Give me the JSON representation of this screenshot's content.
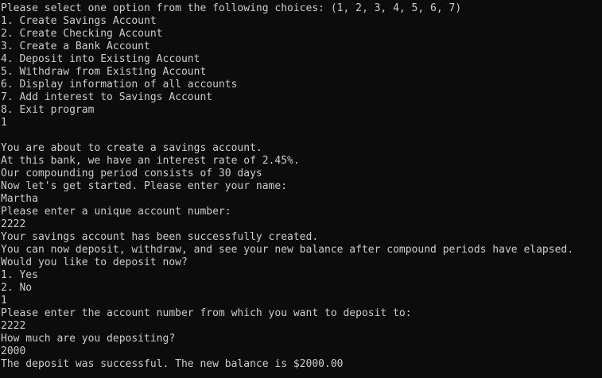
{
  "console": {
    "lines": [
      "Please select one option from the following choices: (1, 2, 3, 4, 5, 6, 7)",
      "1. Create Savings Account",
      "2. Create Checking Account",
      "3. Create a Bank Account",
      "4. Deposit into Existing Account",
      "5. Withdraw from Existing Account",
      "6. Display information of all accounts",
      "7. Add interest to Savings Account",
      "8. Exit program",
      "1",
      "",
      "You are about to create a savings account.",
      "At this bank, we have an interest rate of 2.45%.",
      "Our compounding period consists of 30 days",
      "Now let's get started. Please enter your name:",
      "Martha",
      "Please enter a unique account number:",
      "2222",
      "Your savings account has been successfully created.",
      "You can now deposit, withdraw, and see your new balance after compound periods have elapsed.",
      "Would you like to deposit now?",
      "1. Yes",
      "2. No",
      "1",
      "Please enter the account number from which you want to deposit to:",
      "2222",
      "How much are you depositing?",
      "2000",
      "The deposit was successful. The new balance is $2000.00"
    ]
  }
}
